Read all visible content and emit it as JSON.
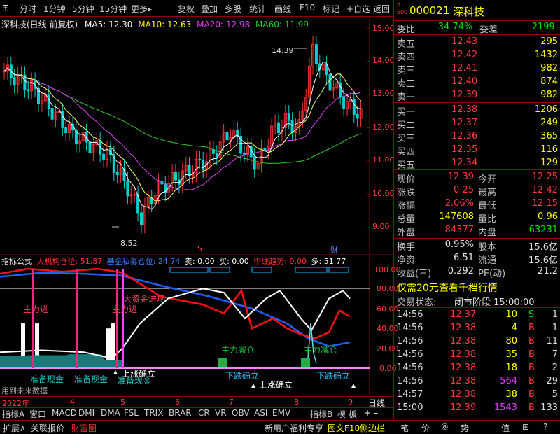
{
  "toolbar": {
    "items": [
      "分时",
      "1分钟",
      "5分钟",
      "15分钟",
      "更多▸",
      "复权",
      "叠加",
      "多股",
      "统计",
      "画线",
      "F10",
      "标记",
      "+自选",
      "返回"
    ]
  },
  "chart_header": {
    "name": "深科技(日线 前复权)",
    "ma5_label": "MA5: 12.30",
    "ma10_label": "MA10: 12.63",
    "ma20_label": "MA20: 12.98",
    "ma60_label": "MA60: 11.99"
  },
  "price_axis": [
    "15.00",
    "14.00",
    "13.00",
    "12.00",
    "11.00",
    "10.00",
    "9.00"
  ],
  "annotations": {
    "high": "14.39",
    "low": "8.52",
    "s_mark": "S",
    "cai_mark": "财"
  },
  "indicator_header": {
    "title": "指标公式",
    "a": "大机构仓位: 51.87",
    "b": "基金私募仓位: 24.74",
    "c": "卖: 0.00",
    "d": "买: 0.00",
    "e": "中线趋势: 0.00",
    "f": "多: 51.77"
  },
  "indicator_axis": [
    "100.00",
    "80.00",
    "60.00",
    "40.00",
    "20.00",
    "0.00"
  ],
  "indicator_labels": {
    "zhuli_jin1": "主力进",
    "zhuli_jin2": "主力进",
    "dazijin": "大资金进场",
    "jiancang1": "主力减仓",
    "jiancang2": "主力减仓",
    "zhunbei1": "准备现金",
    "zhunbei2": "准备现金",
    "zhunbei3": "准备现金",
    "shangzhang1": "上涨确立",
    "shangzhang2": "上涨确立",
    "xiadie1": "下跌确立",
    "xiadie2": "下跌确立",
    "future": "用到未来数据"
  },
  "time_axis": {
    "year": "2022年",
    "m4": "4",
    "m5": "5",
    "m6": "6",
    "m7": "7",
    "m8": "8",
    "m9": "9",
    "period": "日线"
  },
  "tabs": [
    "指标A",
    "窗口",
    "MACD",
    "DMI",
    "DMA",
    "FSL",
    "TRIX",
    "BRAR",
    "CR",
    "VR",
    "OBV",
    "ASI",
    "EMV",
    "指标B",
    "模",
    "板"
  ],
  "quote": {
    "code": "000021",
    "name": "深科技",
    "weibi_label": "委比",
    "weibi": "-34.74%",
    "weicha_label": "委差",
    "weicha": "-2199",
    "asks": [
      {
        "l": "卖五",
        "p": "12.43",
        "v": "295"
      },
      {
        "l": "卖四",
        "p": "12.42",
        "v": "1432"
      },
      {
        "l": "卖三",
        "p": "12.41",
        "v": "982"
      },
      {
        "l": "卖二",
        "p": "12.40",
        "v": "874"
      },
      {
        "l": "卖一",
        "p": "12.39",
        "v": "982"
      }
    ],
    "bids": [
      {
        "l": "买一",
        "p": "12.38",
        "v": "1206"
      },
      {
        "l": "买二",
        "p": "12.37",
        "v": "249"
      },
      {
        "l": "买三",
        "p": "12.36",
        "v": "365"
      },
      {
        "l": "买四",
        "p": "12.35",
        "v": "116"
      },
      {
        "l": "买五",
        "p": "12.34",
        "v": "129"
      }
    ],
    "stats": [
      {
        "a": "现价",
        "b": "12.39",
        "c": "今开",
        "d": "12.25"
      },
      {
        "a": "涨跌",
        "b": "0.25",
        "c": "最高",
        "d": "12.42"
      },
      {
        "a": "涨幅",
        "b": "2.06%",
        "c": "最低",
        "d": "12.15"
      },
      {
        "a": "总量",
        "b": "147608",
        "c": "量比",
        "d": "0.96"
      },
      {
        "a": "外盘",
        "b": "84377",
        "c": "内盘",
        "d": "63231"
      }
    ],
    "stats2": [
      {
        "a": "换手",
        "b": "0.95%",
        "c": "股本",
        "d": "15.6亿"
      },
      {
        "a": "净资",
        "b": "6.51",
        "c": "流通",
        "d": "15.6亿"
      },
      {
        "a": "收益(三)",
        "b": "0.292",
        "c": "PE(动)",
        "d": "21.2"
      }
    ],
    "promo": "仅需20元查看千档行情",
    "status_label": "交易状态:",
    "status": "闭市阶段 15:00:00",
    "ticks": [
      {
        "t": "14:56",
        "p": "12.37",
        "v": "10",
        "s": "S",
        "n": "1"
      },
      {
        "t": "14:56",
        "p": "12.38",
        "v": "4",
        "s": "B",
        "n": "1"
      },
      {
        "t": "14:56",
        "p": "12.38",
        "v": "80",
        "s": "B",
        "n": "11"
      },
      {
        "t": "14:56",
        "p": "12.38",
        "v": "35",
        "s": "B",
        "n": "7"
      },
      {
        "t": "14:56",
        "p": "12.38",
        "v": "18",
        "s": "B",
        "n": "2"
      },
      {
        "t": "14:56",
        "p": "12.38",
        "v": "564",
        "s": "B",
        "n": "29"
      },
      {
        "t": "14:57",
        "p": "12.38",
        "v": "38",
        "s": "B",
        "n": "5"
      },
      {
        "t": "15:00",
        "p": "12.39",
        "v": "1543",
        "s": "B",
        "n": "133"
      }
    ]
  },
  "bottombar": {
    "a": "扩展∧",
    "b": "关联报价",
    "c": "财富圈",
    "d": "新用户福利专享",
    "e": "图文F10",
    "f": "侧边栏",
    "icons": [
      "笔",
      "价",
      "⑥",
      "势",
      "值",
      "⊞",
      "?"
    ]
  }
}
